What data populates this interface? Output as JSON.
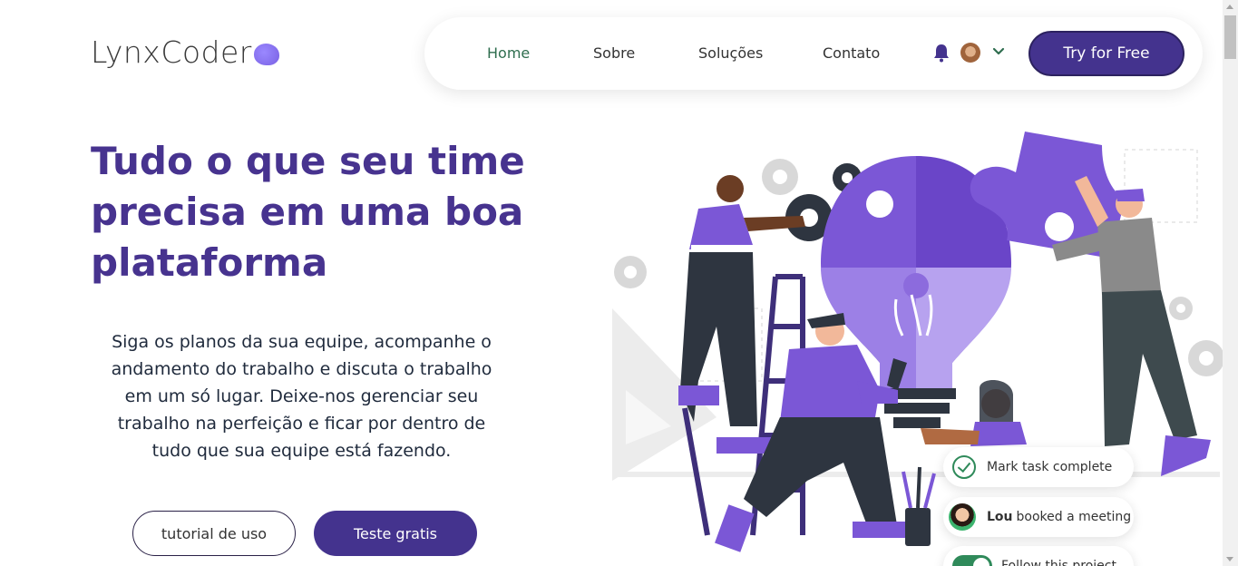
{
  "brand": {
    "name": "LynxCoder"
  },
  "nav": {
    "items": [
      {
        "label": "Home",
        "active": true
      },
      {
        "label": "Sobre",
        "active": false
      },
      {
        "label": "Soluções",
        "active": false
      },
      {
        "label": "Contato",
        "active": false
      }
    ],
    "icons": [
      "bell-icon",
      "avatar",
      "chevron-down-icon"
    ],
    "cta_label": "Try for Free"
  },
  "hero": {
    "title": "Tudo o que seu time precisa em uma boa plataforma",
    "description": "Siga os planos da sua equipe, acompanhe o andamento do trabalho e discuta o trabalho em um só lugar. Deixe-nos gerenciar seu trabalho na perfeição e ficar por dentro de tudo que sua equipe está fazendo.",
    "secondary_button": "tutorial de uso",
    "primary_button": "Teste gratis"
  },
  "cards": {
    "task": {
      "label": "Mark task complete"
    },
    "meeting": {
      "name": "Lou",
      "text": "booked a meeting"
    },
    "project": {
      "label": "Follow this project"
    }
  },
  "colors": {
    "brand_purple": "#44338e",
    "title_purple": "#47338f",
    "accent_violet": "#7b57d6",
    "active_nav": "#2f6e4f",
    "success_green": "#2f8a5a"
  }
}
